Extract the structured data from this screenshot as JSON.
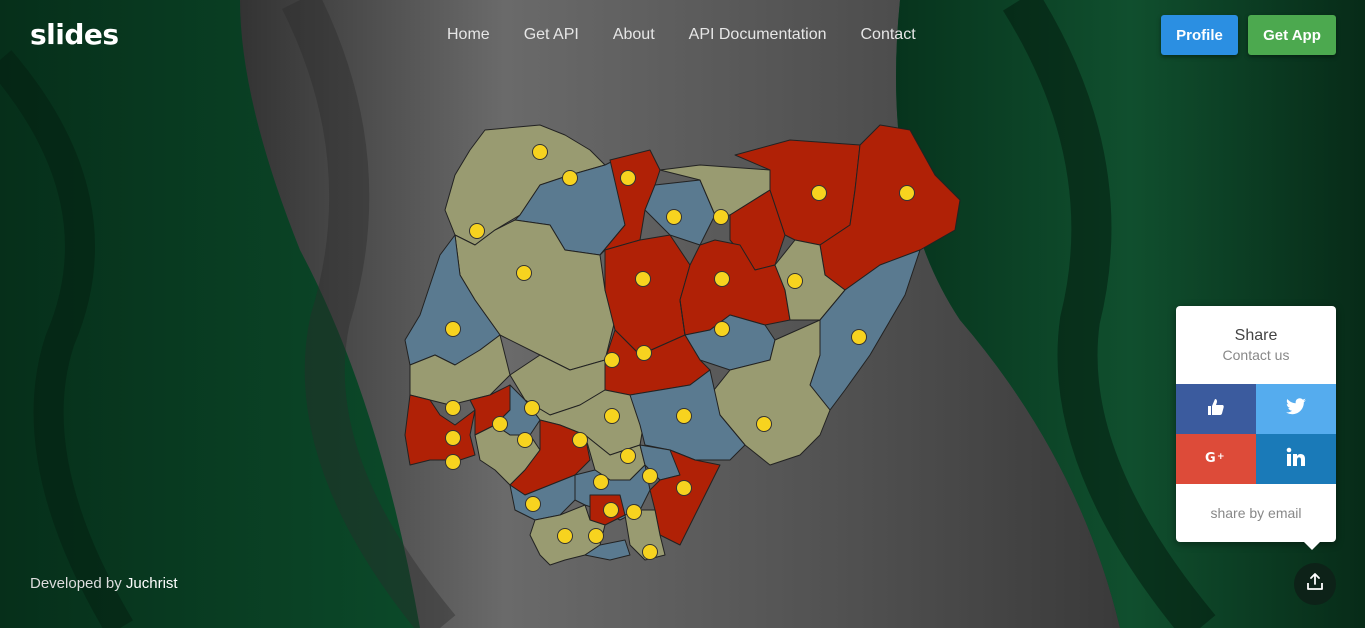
{
  "brand": {
    "logo": "slides"
  },
  "nav": {
    "items": [
      "Home",
      "Get API",
      "About",
      "API Documentation",
      "Contact"
    ]
  },
  "actions": {
    "profile": "Profile",
    "get_app": "Get App"
  },
  "footer": {
    "prefix": "Developed by",
    "author": "Juchrist"
  },
  "share": {
    "title": "Share",
    "subtitle": "Contact us",
    "email": "share by email",
    "buttons": [
      {
        "icon": "thumbs-up-icon",
        "color": "#3b5b9e"
      },
      {
        "icon": "twitter-icon",
        "color": "#55acee"
      },
      {
        "icon": "google-plus-icon",
        "color": "#dd4b39"
      },
      {
        "icon": "linkedin-icon",
        "color": "#1a7ab8"
      }
    ]
  },
  "colors": {
    "flag_green": "#0e4a2b",
    "flag_white": "#5a5a5a",
    "state_red": "#b02106",
    "state_olive": "#999b71",
    "state_blue": "#5a7a90",
    "marker": "#f7d31f"
  }
}
